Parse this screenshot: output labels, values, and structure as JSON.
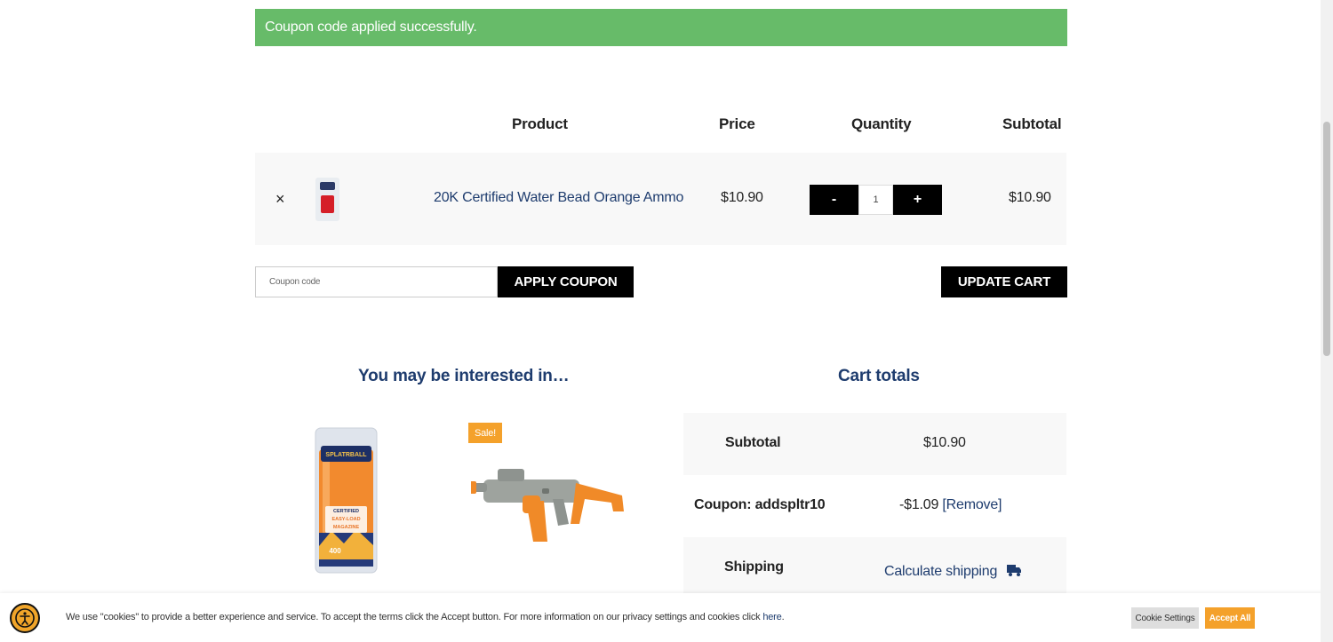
{
  "notice": {
    "text": "Coupon code applied successfully."
  },
  "cart": {
    "headers": {
      "product": "Product",
      "price": "Price",
      "quantity": "Quantity",
      "subtotal": "Subtotal"
    },
    "item": {
      "remove": "×",
      "name": "20K Certified Water Bead Orange Ammo",
      "price": "$10.90",
      "qty_minus": "-",
      "qty": "1",
      "qty_plus": "+",
      "subtotal": "$10.90"
    },
    "coupon_placeholder": "Coupon code",
    "apply_coupon": "APPLY COUPON",
    "update_cart": "UPDATE CART"
  },
  "recommendations": {
    "title": "You may be interested in…",
    "sale_badge": "Sale!",
    "magazine_brand": "SPLATRBALL",
    "magazine_line1": "CERTIFIED",
    "magazine_line2": "EASY-LOAD",
    "magazine_line3": "MAGAZINE",
    "magazine_count": "400"
  },
  "totals": {
    "title": "Cart totals",
    "subtotal_label": "Subtotal",
    "subtotal_value": "$10.90",
    "coupon_label": "Coupon: addspltr10",
    "coupon_value": "-$1.09",
    "coupon_remove": "[Remove]",
    "shipping_label": "Shipping",
    "shipping_value": "Calculate shipping"
  },
  "cookie": {
    "text": "We use \"cookies\" to provide a better experience and service. To accept the terms click the Accept button. For more information on our privacy settings and cookies click",
    "link": "here",
    "settings": "Cookie Settings",
    "accept": "Accept All"
  },
  "colors": {
    "notice_green": "#67bb69",
    "navy": "#1e3c6e",
    "orange": "#f4a12b"
  }
}
